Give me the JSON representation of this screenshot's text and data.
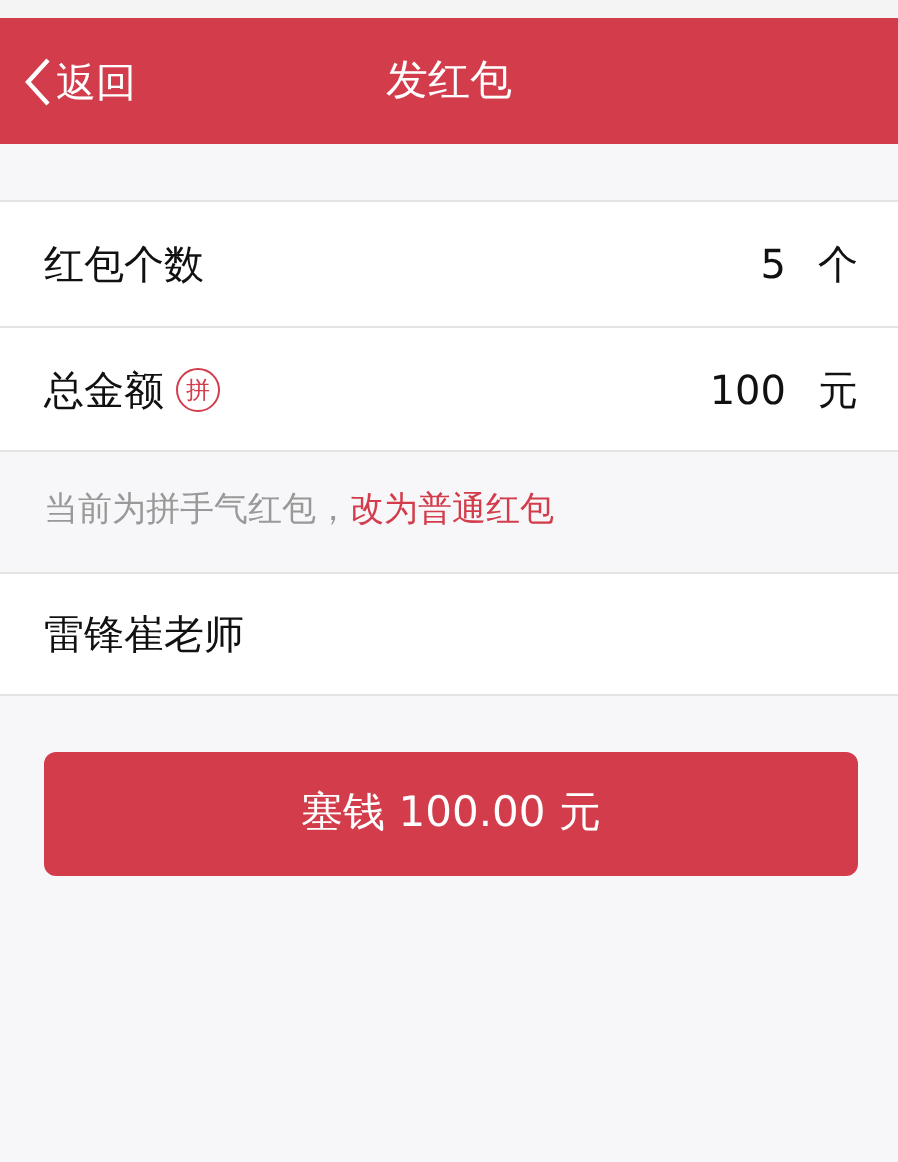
{
  "nav_bar": {
    "back_label": "返回",
    "title": "发红包"
  },
  "fields": [
    {
      "label": "红包个数",
      "value": "5",
      "unit": "个"
    },
    {
      "label": "总金额",
      "badge": "拼",
      "value": "100",
      "unit": "元"
    }
  ],
  "hint": {
    "text": "当前为拼手气红包，",
    "link": "改为普通红包"
  },
  "greeting": {
    "value": "雷锋崔老师"
  },
  "submit_button": "塞钱 100.00 元"
}
